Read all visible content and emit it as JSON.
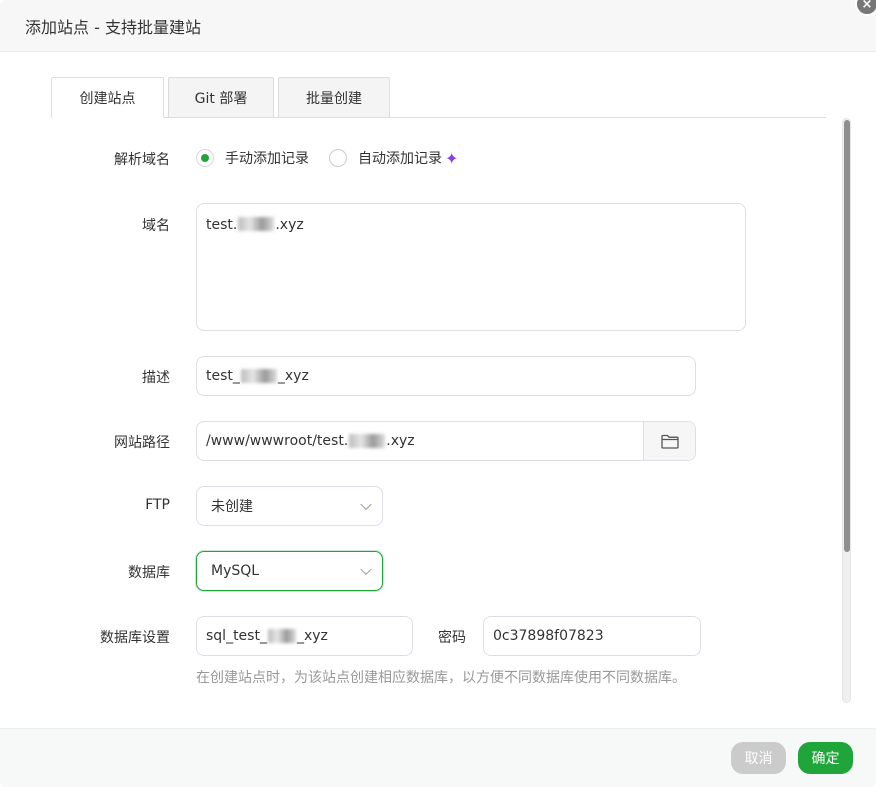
{
  "dialog": {
    "title": "添加站点 - 支持批量建站",
    "close_glyph": "×"
  },
  "tabs": [
    {
      "label": "创建站点",
      "active": true
    },
    {
      "label": "Git 部署",
      "active": false
    },
    {
      "label": "批量创建",
      "active": false
    }
  ],
  "form": {
    "dns": {
      "label": "解析域名",
      "options": [
        {
          "label": "手动添加记录",
          "checked": true
        },
        {
          "label": "自动添加记录",
          "checked": false
        }
      ],
      "sparkle_icon": "✦"
    },
    "domain": {
      "label": "域名",
      "value_prefix": "test.",
      "value_suffix": ".xyz"
    },
    "description": {
      "label": "描述",
      "value_prefix": "test_",
      "value_suffix": "_xyz"
    },
    "path": {
      "label": "网站路径",
      "value_prefix": "/www/wwwroot/test.",
      "value_suffix": ".xyz",
      "button_icon": "folder-icon"
    },
    "ftp": {
      "label": "FTP",
      "value": "未创建"
    },
    "database": {
      "label": "数据库",
      "value": "MySQL"
    },
    "db_settings": {
      "label": "数据库设置",
      "name_prefix": "sql_test_",
      "name_suffix": "_xyz",
      "password_label": "密码",
      "password_value": "0c37898f07823"
    },
    "hint": "在创建站点时，为该站点创建相应数据库，以方便不同数据库使用不同数据库。"
  },
  "footer": {
    "cancel_label": "取消",
    "ok_label": "确定"
  },
  "colors": {
    "accent": "#20a53a",
    "cancel": "#cbcbcb",
    "sparkle": "#8a3ee8"
  }
}
